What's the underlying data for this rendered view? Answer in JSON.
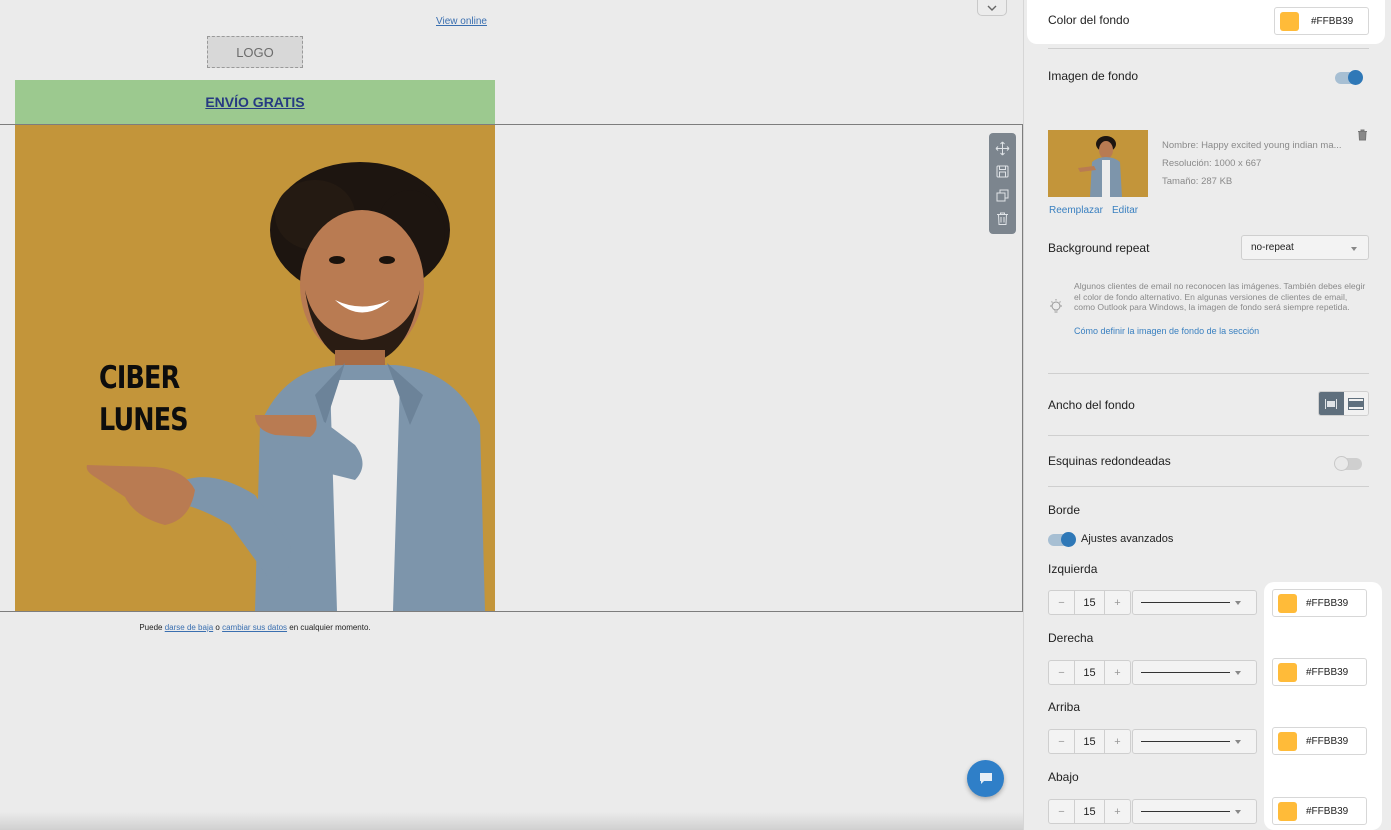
{
  "canvas": {
    "view_online": "View online",
    "logo": "LOGO",
    "free_shipping": "ENVÍO GRATIS",
    "hero_line1": "CIBER",
    "hero_line2": "LUNES",
    "footer_prefix": "Puede",
    "footer_link1": "darse de baja",
    "footer_mid": "o",
    "footer_link2": "cambiar sus datos",
    "footer_suffix": "en cualquier momento.",
    "row_tools": [
      "move-icon",
      "save-icon",
      "duplicate-icon",
      "trash-icon"
    ]
  },
  "panel": {
    "bg_color_label": "Color del fondo",
    "bg_color_value": "#FFBB39",
    "bg_image_label": "Imagen de fondo",
    "bg_image_enabled": true,
    "image_name": "Nombre: Happy excited young indian ma...",
    "image_resolution": "Resolución: 1000 x 667",
    "image_size": "Tamaño: 287 KB",
    "replace_label": "Reemplazar",
    "edit_label": "Editar",
    "repeat_label": "Background repeat",
    "repeat_value": "no-repeat",
    "hint_text": "Algunos clientes de email no reconocen las imágenes. También debes elegir el color de fondo alternativo. En algunas versiones de clientes de email, como Outlook para Windows, la imagen de fondo será siempre repetida.",
    "hint_link": "Cómo definir la imagen de fondo de la sección",
    "width_label": "Ancho del fondo",
    "rounded_label": "Esquinas redondeadas",
    "rounded_enabled": false,
    "border_label": "Borde",
    "advanced_label": "Ajustes avanzados",
    "advanced_enabled": true,
    "borders": [
      {
        "label": "Izquierda",
        "width": "15",
        "color": "#FFBB39"
      },
      {
        "label": "Derecha",
        "width": "15",
        "color": "#FFBB39"
      },
      {
        "label": "Arriba",
        "width": "15",
        "color": "#FFBB39"
      },
      {
        "label": "Abajo",
        "width": "15",
        "color": "#FFBB39"
      }
    ],
    "minus": "−",
    "plus": "+"
  },
  "colors": {
    "accent": "#FFBB39",
    "link": "#3A80C0",
    "toggle_on": "#2F78B7"
  }
}
